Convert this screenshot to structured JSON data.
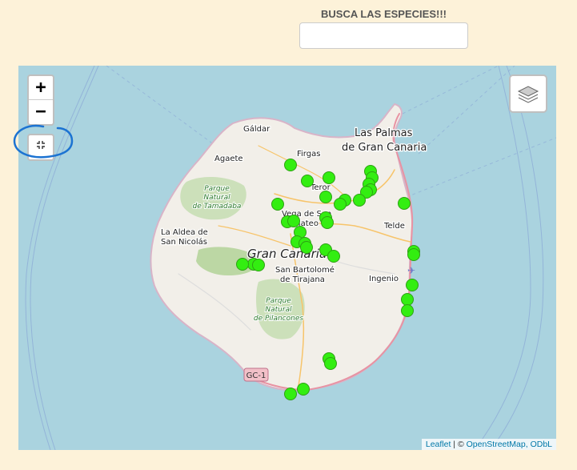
{
  "search": {
    "title": "BUSCA LAS ESPECIES!!!",
    "placeholder": "",
    "value": ""
  },
  "map": {
    "zoom_in_label": "+",
    "zoom_out_label": "−",
    "fullscreen_icon": "fullscreen-toggle-icon",
    "layers_icon": "layers-icon",
    "marker_color": "#33ee11",
    "labels": {
      "galdar": "Gáldar",
      "agaete": "Agaete",
      "firgas": "Firgas",
      "teror": "Teror",
      "las_palmas_1": "Las Palmas",
      "las_palmas_2": "de Gran Canaria",
      "park_tamadaba_1": "Parque",
      "park_tamadaba_2": "Natural",
      "park_tamadaba_3": "de Tamadaba",
      "vega_1": "Vega de San",
      "vega_2": "Mateo",
      "telde": "Telde",
      "aldea_1": "La Aldea de",
      "aldea_2": "San Nicolás",
      "gran_canaria": "Gran Canaria",
      "sb_1": "San Bartolomé",
      "sb_2": "de Tirajana",
      "ingenio": "Ingenio",
      "park_pilancones_1": "Parque",
      "park_pilancones_2": "Natural",
      "park_pilancones_3": "de Pilancones",
      "road": "GC-1"
    }
  },
  "attribution": {
    "leaflet": "Leaflet",
    "separator": " | © ",
    "osm": "OpenStreetMap, ODbL"
  }
}
